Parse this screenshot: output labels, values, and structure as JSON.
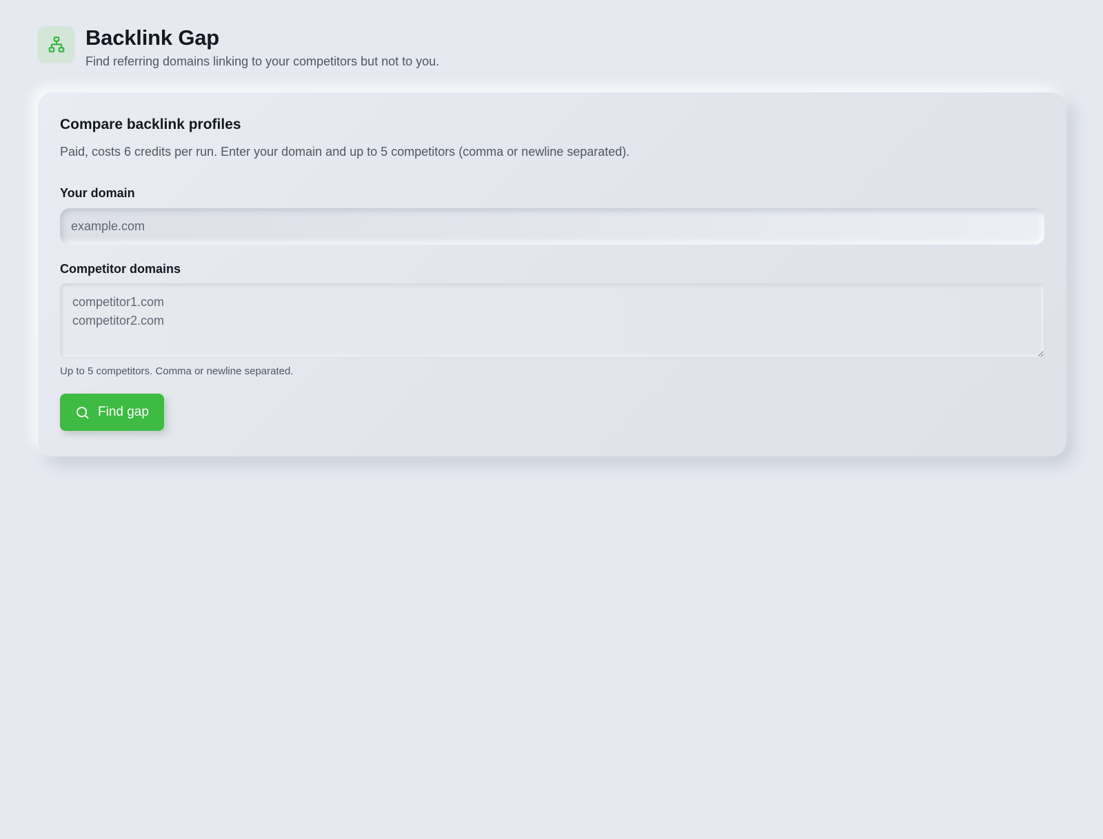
{
  "header": {
    "icon": "sitemap-icon",
    "title": "Backlink Gap",
    "subtitle": "Find referring domains linking to your competitors but not to you."
  },
  "card": {
    "title": "Compare backlink profiles",
    "description": "Paid, costs 6 credits per run. Enter your domain and up to 5 competitors (comma or newline separated).",
    "domain_field": {
      "label": "Your domain",
      "placeholder": "example.com",
      "value": ""
    },
    "competitors_field": {
      "label": "Competitor domains",
      "placeholder": "competitor1.com\ncompetitor2.com",
      "value": "",
      "hint": "Up to 5 competitors. Comma or newline separated."
    },
    "submit_button": {
      "label": "Find gap",
      "icon": "search-icon"
    }
  },
  "colors": {
    "background": "#e6e9f0",
    "accent": "#3dbb42",
    "icon_tile": "#d3e6d8",
    "text_primary": "#14181f",
    "text_secondary": "#4f5663"
  }
}
